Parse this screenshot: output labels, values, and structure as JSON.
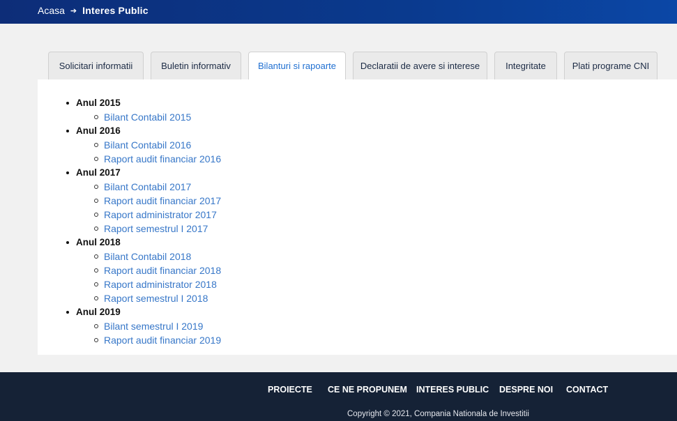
{
  "breadcrumb": {
    "home": "Acasa",
    "separator_icon": "arrow-right-icon",
    "current": "Interes Public"
  },
  "tabs": [
    {
      "label": "Solicitari informatii",
      "active": false
    },
    {
      "label": "Buletin informativ",
      "active": false
    },
    {
      "label": "Bilanturi si rapoarte",
      "active": true
    },
    {
      "label": "Declaratii de avere si interese",
      "active": false
    },
    {
      "label": "Integritate",
      "active": false
    },
    {
      "label": "Plati programe CNI",
      "active": false
    }
  ],
  "years": [
    {
      "label": "Anul 2015",
      "items": [
        "Bilant Contabil 2015"
      ]
    },
    {
      "label": "Anul 2016",
      "items": [
        "Bilant Contabil 2016",
        "Raport audit financiar 2016"
      ]
    },
    {
      "label": "Anul 2017",
      "items": [
        "Bilant Contabil 2017",
        "Raport audit financiar 2017",
        "Raport administrator 2017",
        "Raport semestrul I 2017"
      ]
    },
    {
      "label": "Anul 2018",
      "items": [
        "Bilant Contabil 2018",
        "Raport audit financiar 2018",
        "Raport administrator 2018",
        "Raport semestrul I 2018"
      ]
    },
    {
      "label": "Anul 2019",
      "items": [
        "Bilant semestrul I 2019",
        "Raport audit financiar 2019"
      ]
    }
  ],
  "footer": {
    "nav": [
      "PROIECTE",
      "CE NE PROPUNEM",
      "INTERES PUBLIC",
      "DESPRE NOI",
      "CONTACT"
    ],
    "copyright": "Copyright © 2021, Compania Nationala de Investitii"
  },
  "colors": {
    "header_bg": "#0b3a8c",
    "link": "#3777c8",
    "active_tab": "#1f6fd1",
    "footer_bg": "#152236"
  }
}
